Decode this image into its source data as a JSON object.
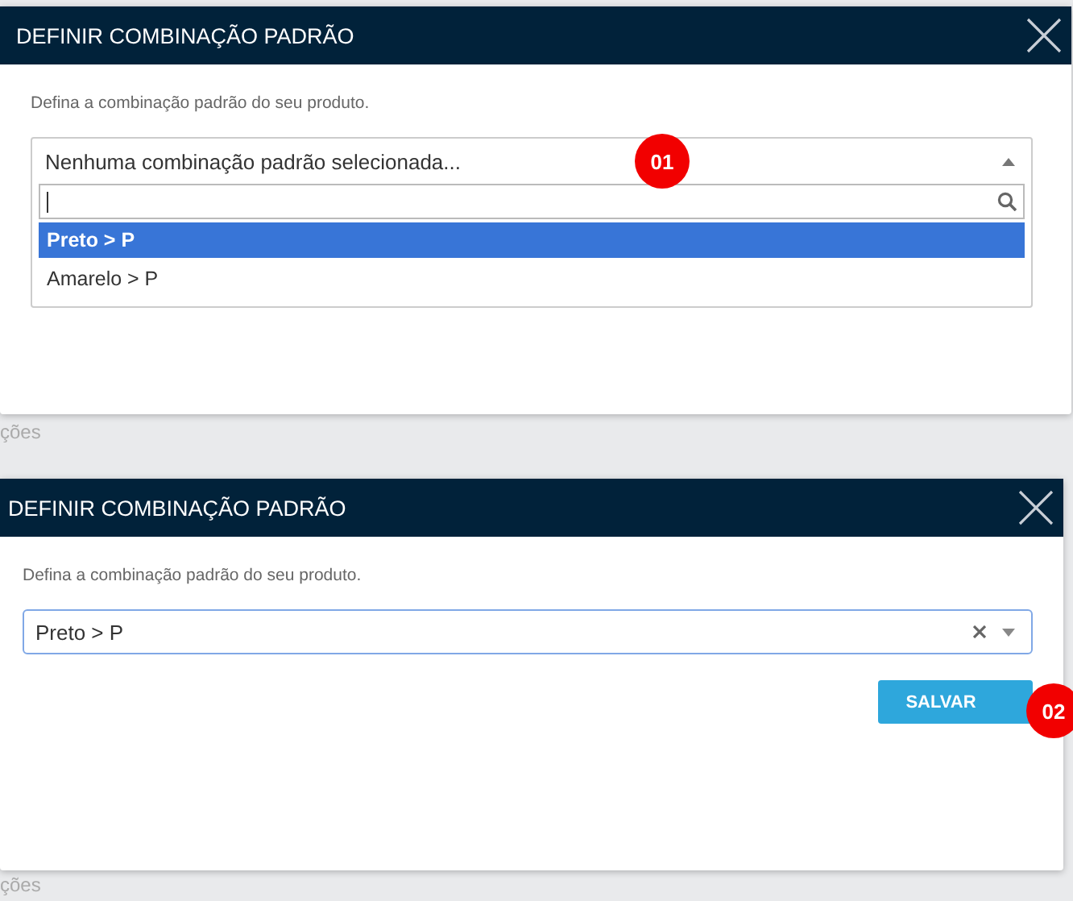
{
  "panels": [
    {
      "title": "DEFINIR COMBINAÇÃO PADRÃO",
      "description": "Defina a combinação padrão do seu produto.",
      "select": {
        "kind": "open",
        "placeholder": "Nenhuma combinação padrão selecionada...",
        "options": [
          {
            "label": "Preto > P",
            "selected": true
          },
          {
            "label": "Amarelo > P",
            "selected": false
          }
        ]
      },
      "badge": "01",
      "background_text": "ções"
    },
    {
      "title": "DEFINIR COMBINAÇÃO PADRÃO",
      "description": "Defina a combinação padrão do seu produto.",
      "select": {
        "kind": "closed",
        "value": "Preto > P"
      },
      "button": "SALVAR",
      "badge": "02",
      "background_text": "ções"
    }
  ]
}
